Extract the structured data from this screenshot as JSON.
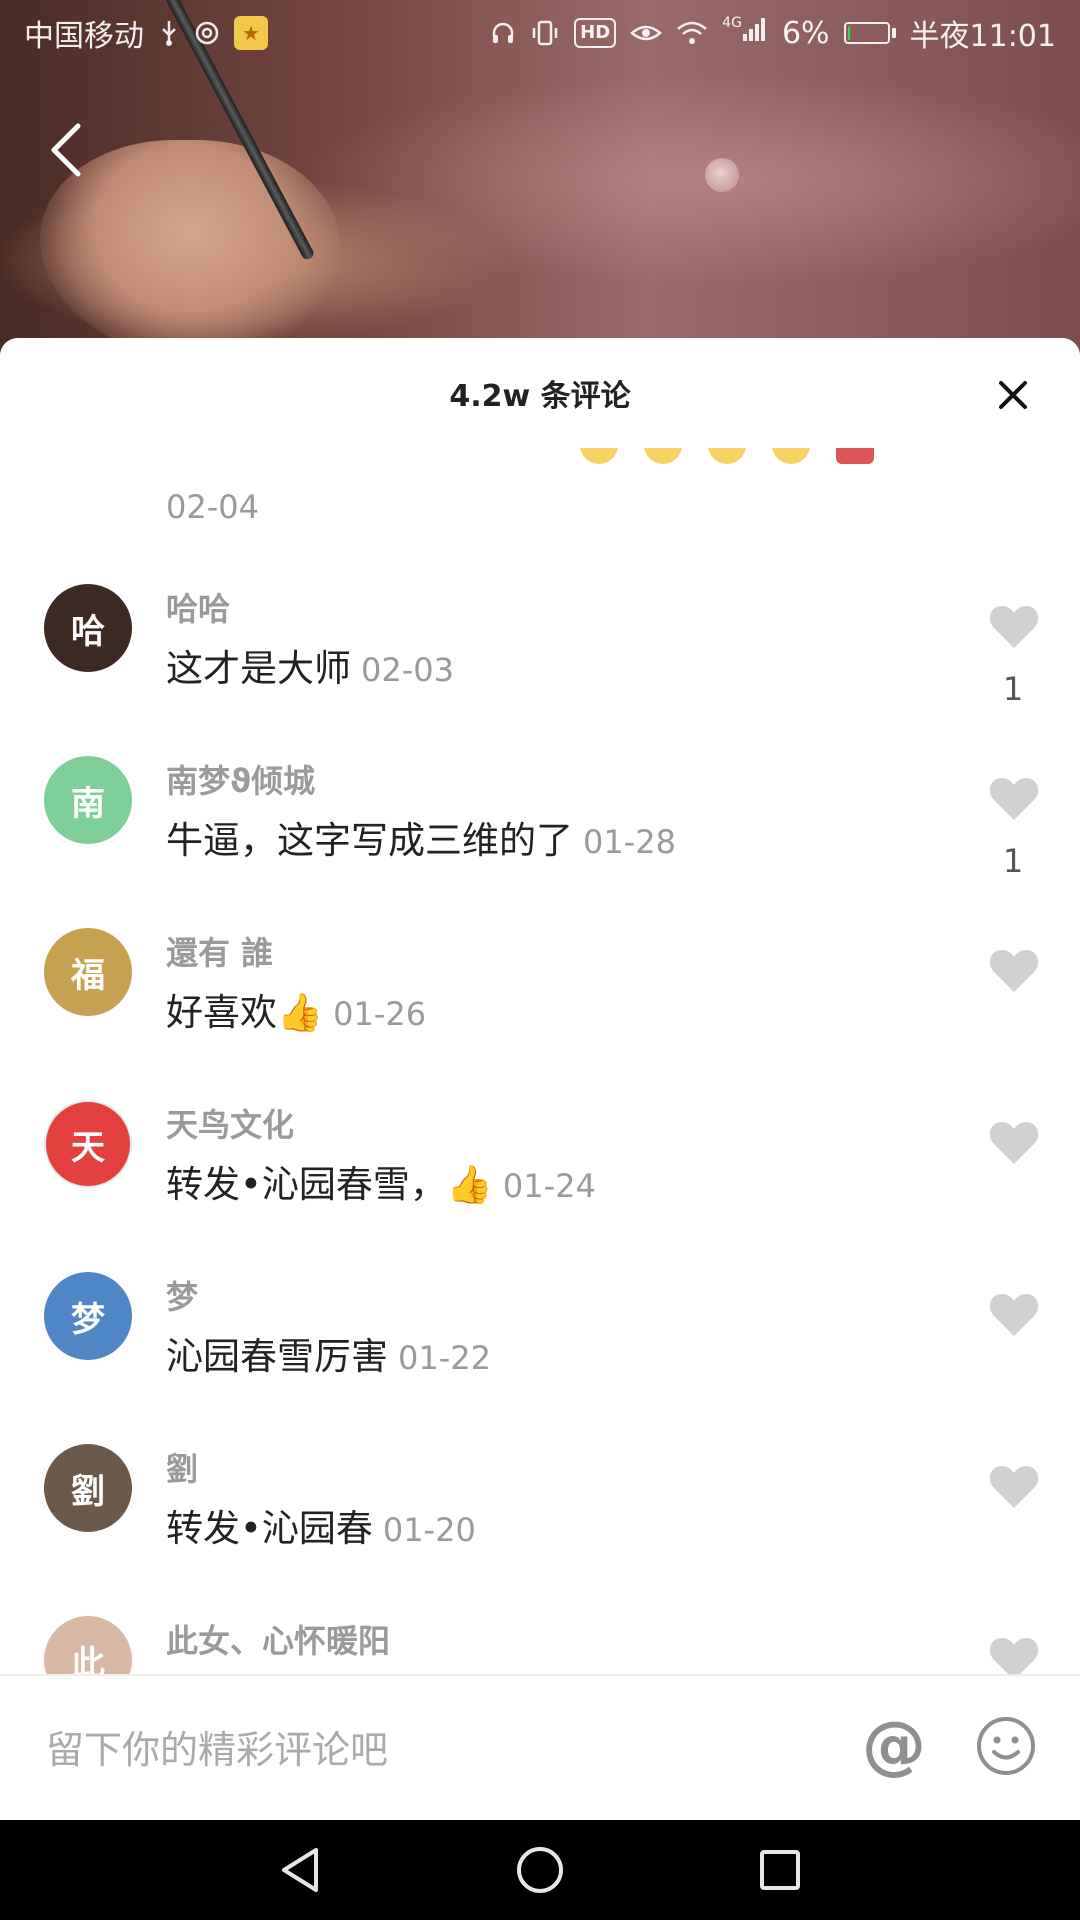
{
  "status_bar": {
    "carrier": "中国移动",
    "icons_left": [
      "usb-icon",
      "hotspot-icon",
      "star-app-icon"
    ],
    "icons_right": [
      "headphones-icon",
      "vibrate-icon",
      "hd-icon",
      "eye-icon",
      "wifi-icon",
      "signal-4g-icon",
      "battery-icon"
    ],
    "hd_label": "HD",
    "network_label": "4G",
    "battery_percent": "6%",
    "time": "半夜11:01"
  },
  "video": {
    "back_icon": "back-arrow-icon"
  },
  "comments_panel": {
    "title": "4.2w 条评论",
    "close_icon": "close-icon",
    "previous_tail_date": "02-04",
    "comments": [
      {
        "username": "哈哈",
        "text": "这才是大师",
        "date": "02-03",
        "likes": "1",
        "avatar_initial": "哈",
        "avatar_color": "#3d2a25"
      },
      {
        "username": "南梦ϑ倾城",
        "text": "牛逼，这字写成三维的了",
        "date": "01-28",
        "likes": "1",
        "avatar_initial": "南",
        "avatar_color": "#7fcf9a"
      },
      {
        "username": "還有 誰",
        "text": "好喜欢👍",
        "date": "01-26",
        "likes": "",
        "avatar_initial": "福",
        "avatar_color": "#c7a152"
      },
      {
        "username": "天鸟文化",
        "text": "转发•沁园春雪，👍",
        "date": "01-24",
        "likes": "",
        "avatar_initial": "天",
        "avatar_color": "#e44040"
      },
      {
        "username": "梦",
        "text": "沁园春雪厉害",
        "date": "01-22",
        "likes": "",
        "avatar_initial": "梦",
        "avatar_color": "#4f86c6"
      },
      {
        "username": "劉",
        "text": "转发•沁园春",
        "date": "01-20",
        "likes": "",
        "avatar_initial": "劉",
        "avatar_color": "#6b5a4c"
      },
      {
        "username": "此女、心怀暖阳",
        "text": "",
        "date": "",
        "likes": "",
        "avatar_initial": "此",
        "avatar_color": "#d9b8a6"
      }
    ]
  },
  "input_bar": {
    "placeholder": "留下你的精彩评论吧",
    "at_label": "@",
    "emoji_icon": "emoji-icon"
  },
  "nav_bar": {
    "buttons": [
      "back-triangle-icon",
      "home-circle-icon",
      "recents-square-icon"
    ]
  },
  "colors": {
    "username_gray": "#9a9a9a",
    "text_dark": "#222222",
    "icon_gray": "#8f8f8f",
    "heart_gray": "#d0d0d0",
    "sheet_bg": "#ffffff"
  }
}
